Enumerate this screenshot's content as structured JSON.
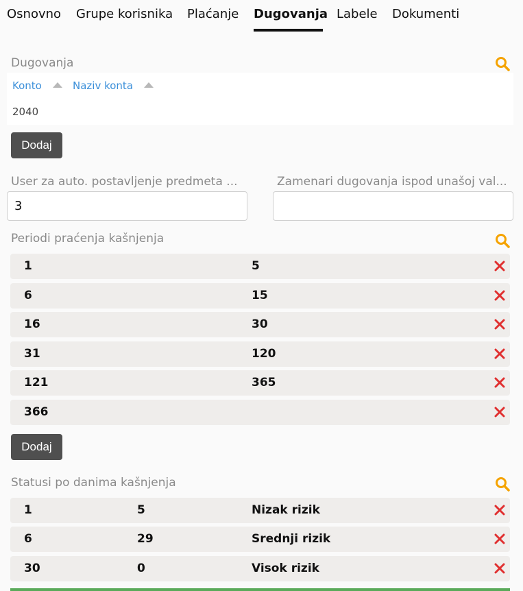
{
  "tabs": [
    {
      "label": "Osnovno"
    },
    {
      "label": "Grupe korisnika"
    },
    {
      "label": "Plaćanje"
    },
    {
      "label": "Dugovanja"
    },
    {
      "label": "Labele"
    },
    {
      "label": "Dokumenti"
    }
  ],
  "active_tab": "Dugovanja",
  "dugovanja": {
    "title": "Dugovanja",
    "columns": [
      "Konto",
      "Naziv konta"
    ],
    "rows": [
      {
        "konto": "2040",
        "naziv": ""
      }
    ],
    "add_label": "Dodaj"
  },
  "fields": {
    "user_label": "User za auto. postavljenje predmeta ...",
    "user_value": "3",
    "zamenari_label": "Zamenari dugovanja ispod unašoj val...",
    "zamenari_value": ""
  },
  "periodi": {
    "title": "Periodi praćenja kašnjenja",
    "rows": [
      {
        "from": "1",
        "to": "5"
      },
      {
        "from": "6",
        "to": "15"
      },
      {
        "from": "16",
        "to": "30"
      },
      {
        "from": "31",
        "to": "120"
      },
      {
        "from": "121",
        "to": "365"
      },
      {
        "from": "366",
        "to": ""
      }
    ],
    "add_label": "Dodaj"
  },
  "statusi": {
    "title": "Statusi po danima kašnjenja",
    "rows": [
      {
        "from": "1",
        "to": "5",
        "status": "Nizak rizik"
      },
      {
        "from": "6",
        "to": "29",
        "status": "Srednji rizik"
      },
      {
        "from": "30",
        "to": "0",
        "status": "Visok rizik"
      }
    ]
  },
  "colors": {
    "accent_search": "#f5a300",
    "delete": "#e03030",
    "link": "#3b8fd9",
    "button": "#4f4f4f"
  },
  "icons": {
    "search": "search-icon",
    "delete": "close-icon",
    "sort": "sort-up-icon"
  }
}
